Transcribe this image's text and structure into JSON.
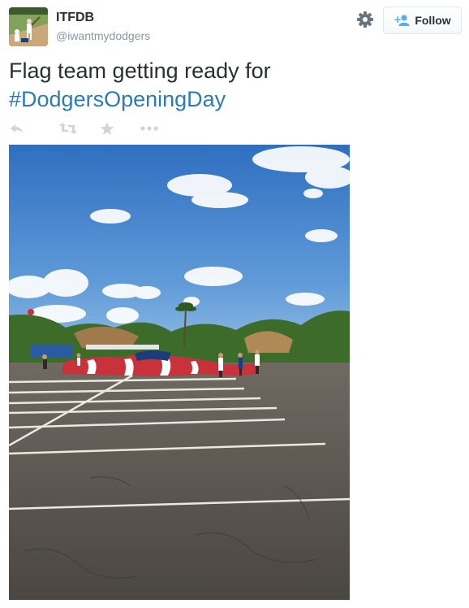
{
  "user": {
    "name": "ITFDB",
    "handle": "@iwantmydodgers",
    "avatar_icon": "baseball-player-avatar-icon"
  },
  "header": {
    "settings_icon": "gear-icon",
    "follow_label": "Follow",
    "follow_icon": "add-user-icon"
  },
  "tweet": {
    "text": "Flag team getting ready for",
    "hashtag": "#DodgersOpeningDay"
  },
  "actions": [
    {
      "icon": "reply-icon"
    },
    {
      "icon": "retweet-icon"
    },
    {
      "icon": "favorite-star-icon"
    },
    {
      "icon": "more-dots-icon"
    }
  ],
  "colors": {
    "text": "#292f33",
    "muted": "#8899a6",
    "link": "#2b7bb9",
    "icon": "#ccd6dd"
  },
  "media": {
    "photo_icon": "parking-lot-flag-photo"
  }
}
